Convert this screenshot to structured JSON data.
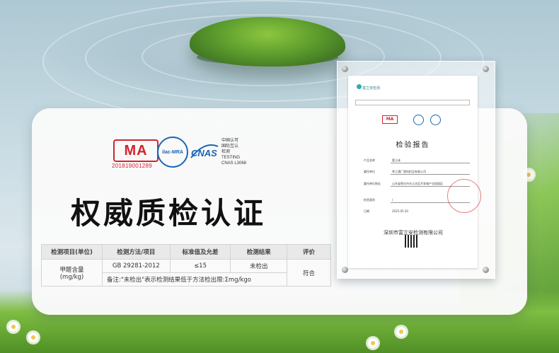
{
  "certification": {
    "cma_label": "MA",
    "cma_number": "201819001289",
    "ilac_label": "ilac-MRA",
    "cnas_label": "CNAS",
    "cnas_text": [
      "中国认可",
      "国际互认",
      "检测",
      "TESTING",
      "CNAS L3068"
    ]
  },
  "headline": "权威质检认证",
  "test_table": {
    "headers": [
      "检测项目(单位)",
      "检测方法/项目",
      "标准值及允差",
      "检测结果",
      "评价"
    ],
    "row": {
      "item": "甲醛含量\n(mg/kg)",
      "method": "GB 29281-2012",
      "standard": "≤15",
      "result": "未检出",
      "evaluation": "符合"
    },
    "note": "备注:\"未检出\"表示检测结果低于方法检出限:Σmg/kgo"
  },
  "report": {
    "lab_name": "富立安检测",
    "title": "检验报告",
    "fields": [
      {
        "label": "产品名称",
        "value": "婴儿床"
      },
      {
        "label": "委托单位",
        "value": "李江通厂塑纺织品有限公司"
      },
      {
        "label": "委托单位地址",
        "value": "山东省枣庄市台儿庄区开发城产业园园区"
      },
      {
        "label": "检验类别",
        "value": "/"
      },
      {
        "label": "日期",
        "value": "2025.05.20"
      }
    ],
    "issuer": "深圳市富立安检测有限公司"
  }
}
